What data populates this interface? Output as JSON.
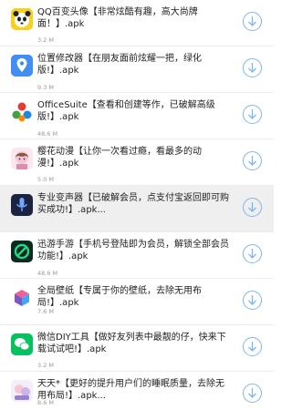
{
  "download_list": {
    "items": [
      {
        "title": "QQ百变头像【非常炫酷有趣，高大尚牌面！】.apk",
        "size": "3.2 M",
        "icon": "panda-icon"
      },
      {
        "title": "位置修改器【在朋友面前炫耀一把，绿化版!】.apk",
        "size": "9.3 M",
        "icon": "location-pin-icon"
      },
      {
        "title": "OfficeSuite【查看和创建等作，已破解高级版!】.apk",
        "size": "48.6 M",
        "icon": "office-suite-icon"
      },
      {
        "title": "樱花动漫【让你一次看过瘾，看最多的动漫!】.apk",
        "size": "5.0 M",
        "icon": "anime-girl-icon"
      },
      {
        "title": "专业变声器【已破解会员，点支付宝返回即可购买成功!】.apk...",
        "size": "",
        "icon": "microphone-icon"
      },
      {
        "title": "迅游手游【手机号登陆即为会员，解锁全部会员功能!】.apk",
        "size": "48.6 M",
        "icon": "xunyou-game-icon"
      },
      {
        "title": "全局壁纸【专属于你的壁纸，去除无用布局!】.apk",
        "size": "7.6 M",
        "icon": "cube-wallpaper-icon"
      },
      {
        "title": "微信DIY工具【做好友列表中最靓的仔，快来下载试试吧!】.apk",
        "size": "3.2 M",
        "icon": "wechat-icon"
      },
      {
        "title": "天天*【更好的提升用户们的睡眠质量，去除无用布局!】.apk...",
        "size": "8.6 M",
        "icon": "sleep-app-icon"
      }
    ]
  },
  "colors": {
    "download_button": "#7fb6ea",
    "highlight_row": "#efefef"
  }
}
